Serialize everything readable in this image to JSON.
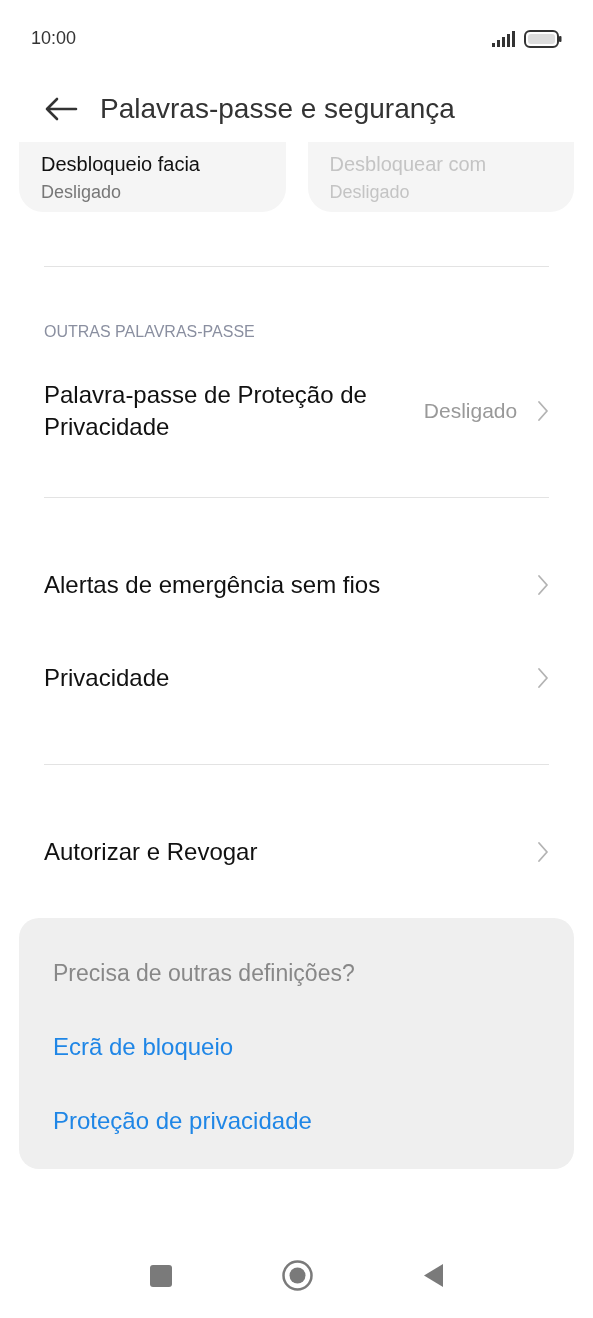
{
  "status_bar": {
    "time": "10:00"
  },
  "header": {
    "title": "Palavras-passe e segurança"
  },
  "cards": [
    {
      "title": "Desbloqueio facia",
      "value": "Desligado",
      "disabled": false
    },
    {
      "title": "Desbloquear com",
      "value": "Desligado",
      "disabled": true
    }
  ],
  "sections": [
    {
      "heading": "OUTRAS PALAVRAS-PASSE",
      "items": [
        {
          "label": "Palavra-passe de Proteção de Privacidade",
          "value": "Desligado"
        }
      ]
    },
    {
      "items": [
        {
          "label": "Alertas de emergência sem fios"
        },
        {
          "label": "Privacidade"
        }
      ]
    },
    {
      "items": [
        {
          "label": "Autorizar e Revogar"
        }
      ]
    }
  ],
  "suggestions": {
    "title": "Precisa de outras definições?",
    "links": [
      "Ecrã de bloqueio",
      "Proteção de privacidade"
    ]
  }
}
